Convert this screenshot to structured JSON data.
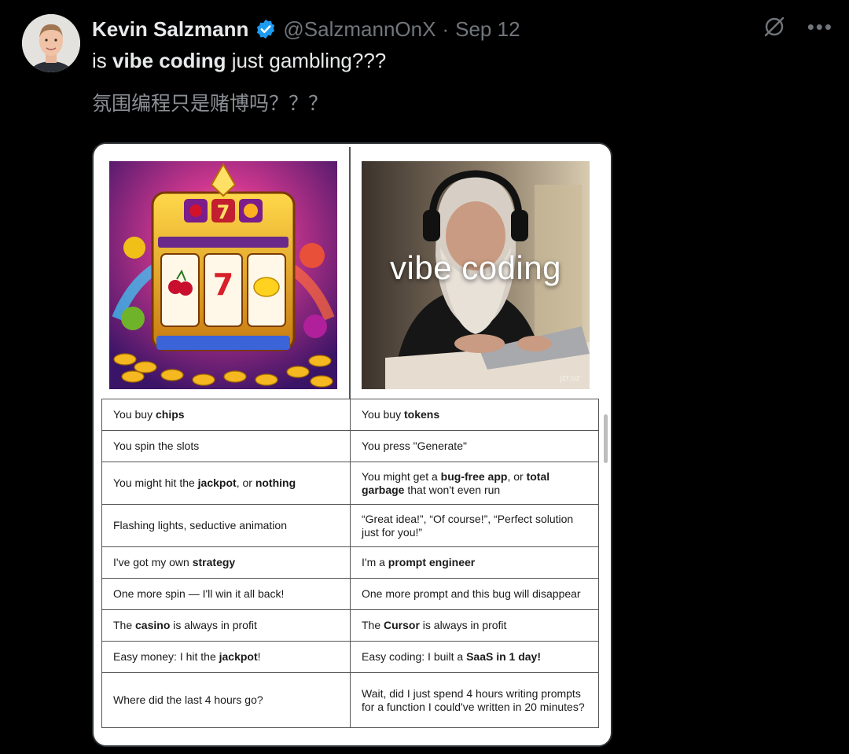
{
  "author": {
    "name": "Kevin Salzmann",
    "handle": "@SalzmannOnX",
    "separator": "·",
    "date": "Sep 12"
  },
  "tweet": {
    "text_parts": [
      {
        "text": "is ",
        "bold": false
      },
      {
        "text": "vibe coding",
        "bold": true
      },
      {
        "text": " just gambling???",
        "bold": false
      }
    ],
    "translation": "氛围编程只是赌博吗？？？"
  },
  "media": {
    "vibe_caption": "vibe coding",
    "watermark": "jzr.uz",
    "rows": [
      {
        "left": [
          {
            "t": "You buy "
          },
          {
            "t": "chips",
            "b": true
          }
        ],
        "right": [
          {
            "t": "You buy "
          },
          {
            "t": "tokens",
            "b": true
          }
        ],
        "h": 40
      },
      {
        "left": [
          {
            "t": "You spin the slots"
          }
        ],
        "right": [
          {
            "t": "You press \"Generate\""
          }
        ],
        "h": 40
      },
      {
        "left": [
          {
            "t": "You might hit the "
          },
          {
            "t": "jackpot",
            "b": true
          },
          {
            "t": ", or "
          },
          {
            "t": "nothing",
            "b": true
          }
        ],
        "right": [
          {
            "t": "You might get a "
          },
          {
            "t": "bug-free app",
            "b": true
          },
          {
            "t": ", or "
          },
          {
            "t": "total garbage",
            "b": true
          },
          {
            "t": " that won't even run"
          }
        ],
        "h": 54
      },
      {
        "left": [
          {
            "t": "Flashing lights, seductive animation"
          }
        ],
        "right": [
          {
            "t": "“Great idea!”, “Of course!”, “Perfect solution just for you!”"
          }
        ],
        "h": 54
      },
      {
        "left": [
          {
            "t": "I've got my own "
          },
          {
            "t": "strategy",
            "b": true
          }
        ],
        "right": [
          {
            "t": "I'm a "
          },
          {
            "t": "prompt engineer",
            "b": true
          }
        ],
        "h": 40
      },
      {
        "left": [
          {
            "t": "One more spin — I'll win it all back!"
          }
        ],
        "right": [
          {
            "t": "One more prompt and this bug will disappear"
          }
        ],
        "h": 40
      },
      {
        "left": [
          {
            "t": "The "
          },
          {
            "t": "casino",
            "b": true
          },
          {
            "t": " is always in profit"
          }
        ],
        "right": [
          {
            "t": "The "
          },
          {
            "t": "Cursor",
            "b": true
          },
          {
            "t": " is always in profit"
          }
        ],
        "h": 40
      },
      {
        "left": [
          {
            "t": "Easy money: I hit the "
          },
          {
            "t": "jackpot",
            "b": true
          },
          {
            "t": "!"
          }
        ],
        "right": [
          {
            "t": "Easy coding: I built a "
          },
          {
            "t": "SaaS in 1 day!",
            "b": true
          }
        ],
        "h": 40
      },
      {
        "left": [
          {
            "t": "Where did the last 4 hours go?"
          }
        ],
        "right": [
          {
            "t": "Wait, did I just spend 4 hours writing prompts for a function I could've written in 20 minutes?"
          }
        ],
        "h": 70
      }
    ]
  },
  "icons": {
    "verified": "verified-badge-icon",
    "grok": "grok-icon",
    "more": "more-icon"
  },
  "colors": {
    "background": "#000000",
    "text": "#e7e9ea",
    "secondary": "#71767b",
    "verified": "#1d9bf0"
  }
}
